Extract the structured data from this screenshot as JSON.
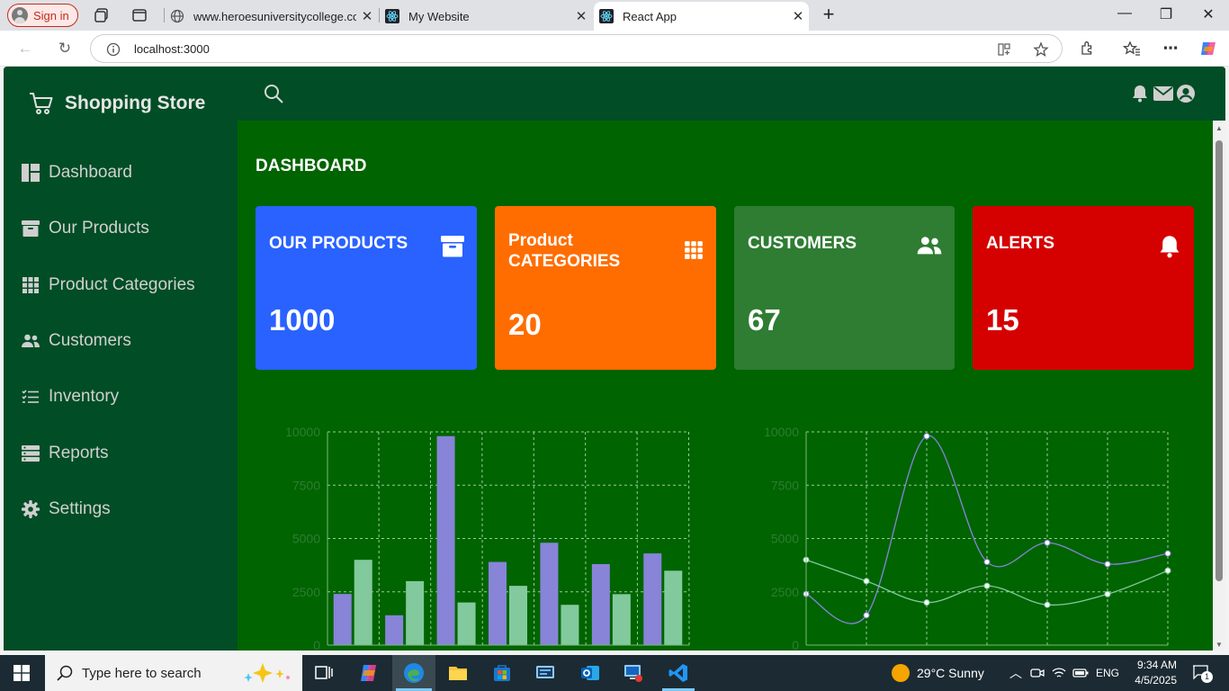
{
  "browser": {
    "signin_label": "Sign in",
    "tabs": [
      {
        "title": "www.heroesuniversitycollege.com"
      },
      {
        "title": "My Website"
      },
      {
        "title": "React App"
      }
    ],
    "url": "localhost:3000"
  },
  "sidebar": {
    "brand": "Shopping Store",
    "items": [
      {
        "label": "Dashboard",
        "icon": "dashboard-icon"
      },
      {
        "label": "Our Products",
        "icon": "archive-icon"
      },
      {
        "label": "Product Categories",
        "icon": "grid-icon"
      },
      {
        "label": "Customers",
        "icon": "users-icon"
      },
      {
        "label": "Inventory",
        "icon": "list-icon"
      },
      {
        "label": "Reports",
        "icon": "server-icon"
      },
      {
        "label": "Settings",
        "icon": "gear-icon"
      }
    ]
  },
  "main": {
    "title": "DASHBOARD",
    "cards": [
      {
        "title": "OUR PRODUCTS",
        "value": "1000",
        "color": "#2962ff",
        "icon": "archive-icon"
      },
      {
        "title_line1": "Product",
        "title_line2": "CATEGORIES",
        "value": "20",
        "color": "#ff6d00",
        "icon": "grid-icon"
      },
      {
        "title": "CUSTOMERS",
        "value": "67",
        "color": "#2e7d32",
        "icon": "users-icon"
      },
      {
        "title": "ALERTS",
        "value": "15",
        "color": "#d50000",
        "icon": "bell-icon"
      }
    ]
  },
  "chart_data": [
    {
      "type": "bar",
      "ylim": [
        0,
        10000
      ],
      "yticks": [
        "0",
        "2500",
        "5000",
        "7500",
        "10000"
      ],
      "categories": [
        "",
        "",
        "",
        "",
        "",
        "",
        ""
      ],
      "series": [
        {
          "values": [
            2400,
            1400,
            9800,
            3900,
            4800,
            3800,
            4300
          ],
          "color": "#8884d8"
        },
        {
          "values": [
            4000,
            3000,
            2000,
            2780,
            1890,
            2390,
            3490
          ],
          "color": "#82ca9d"
        }
      ]
    },
    {
      "type": "line",
      "ylim": [
        0,
        10000
      ],
      "yticks": [
        "0",
        "2500",
        "5000",
        "7500",
        "10000"
      ],
      "categories": [
        "",
        "",
        "",
        "",
        "",
        "",
        ""
      ],
      "series": [
        {
          "values": [
            2400,
            1400,
            9800,
            3900,
            4800,
            3800,
            4300
          ],
          "color": "#8884d8"
        },
        {
          "values": [
            4000,
            3000,
            2000,
            2780,
            1890,
            2390,
            3490
          ],
          "color": "#82ca9d"
        }
      ]
    }
  ],
  "taskbar": {
    "search_placeholder": "Type here to search",
    "weather": "29°C  Sunny",
    "lang": "ENG",
    "time": "9:34 AM",
    "date": "4/5/2025",
    "notification_count": "1"
  }
}
